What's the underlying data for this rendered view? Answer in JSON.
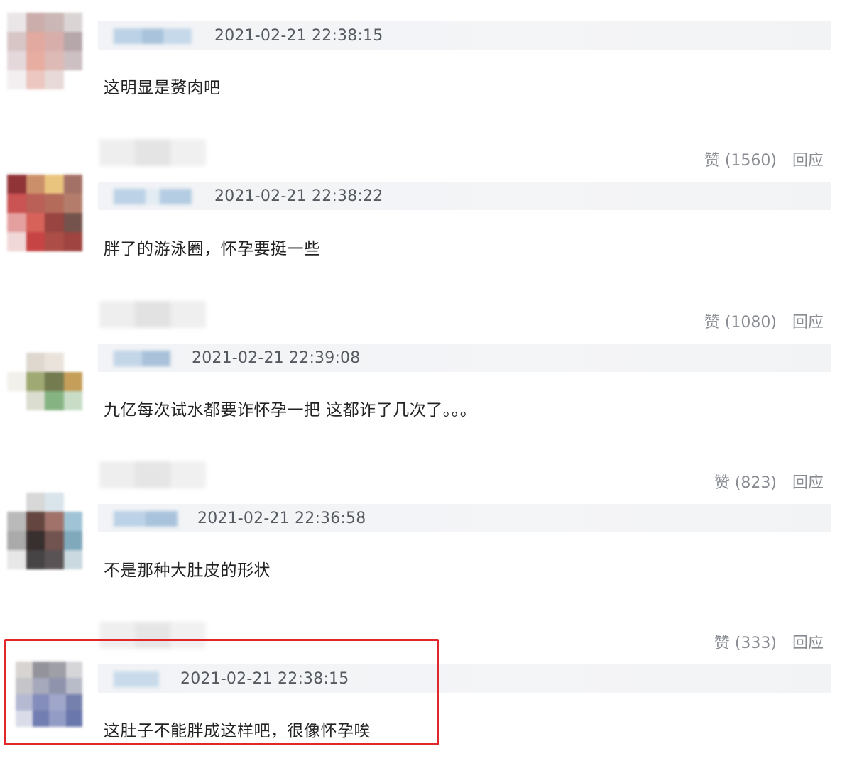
{
  "comments": [
    {
      "timestamp": "2021-02-21 22:38:15",
      "text": "这明显是赘肉吧",
      "like_label": "赞 (1560)",
      "reply_label": "回应"
    },
    {
      "timestamp": "2021-02-21 22:38:22",
      "text": "胖了的游泳圈，怀孕要挺一些",
      "like_label": "赞 (1080)",
      "reply_label": "回应"
    },
    {
      "timestamp": "2021-02-21 22:39:08",
      "text": "九亿每次试水都要诈怀孕一把 这都诈了几次了。。。",
      "like_label": "赞 (823)",
      "reply_label": "回应"
    },
    {
      "timestamp": "2021-02-21 22:36:58",
      "text": "不是那种大肚皮的形状",
      "like_label": "赞 (333)",
      "reply_label": "回应"
    },
    {
      "timestamp": "2021-02-21 22:38:15",
      "text": "这肚子不能胖成这样吧，很像怀孕唉"
    }
  ],
  "colors": {
    "highlight_border": "#e0282a",
    "text": "#222222",
    "meta": "#888c92"
  }
}
